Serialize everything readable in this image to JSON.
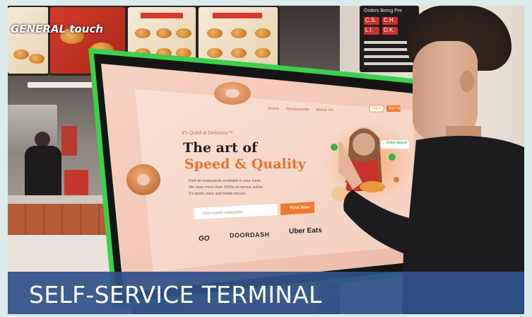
{
  "photo": {
    "description_alt": "",
    "colors": {
      "bezel": "#3bd14a",
      "banner": "#2f528a",
      "accent_orange": "#f07a2c"
    }
  },
  "signage": {
    "brand": "GENERAL touch"
  },
  "order_board": {
    "header": "Orders Being Pre",
    "cells": [
      "C.S.",
      "C.H.",
      "L.I.",
      "D.K."
    ]
  },
  "screen": {
    "nav": [
      "Home",
      "Restaurants",
      "About Us"
    ],
    "login": "Log In",
    "signup": "Sign Up",
    "tagline": "It's Quick & Delicious™",
    "headline_line1": "The art of",
    "headline_line2": "Speed & Quality",
    "body_lines": [
      "Find all restaurants available in your zone.",
      "We have more than 1000s of menus online.",
      "It's quick, easy and totally secure."
    ],
    "search_placeholder": "Find nearby restaurant...",
    "search_button": "Find Now",
    "order_badge": "Order placed",
    "partners": [
      "GO",
      "DOORDASH",
      "Uber Eats"
    ]
  },
  "banner": {
    "title": "SELF-SERVICE TERMINAL"
  }
}
